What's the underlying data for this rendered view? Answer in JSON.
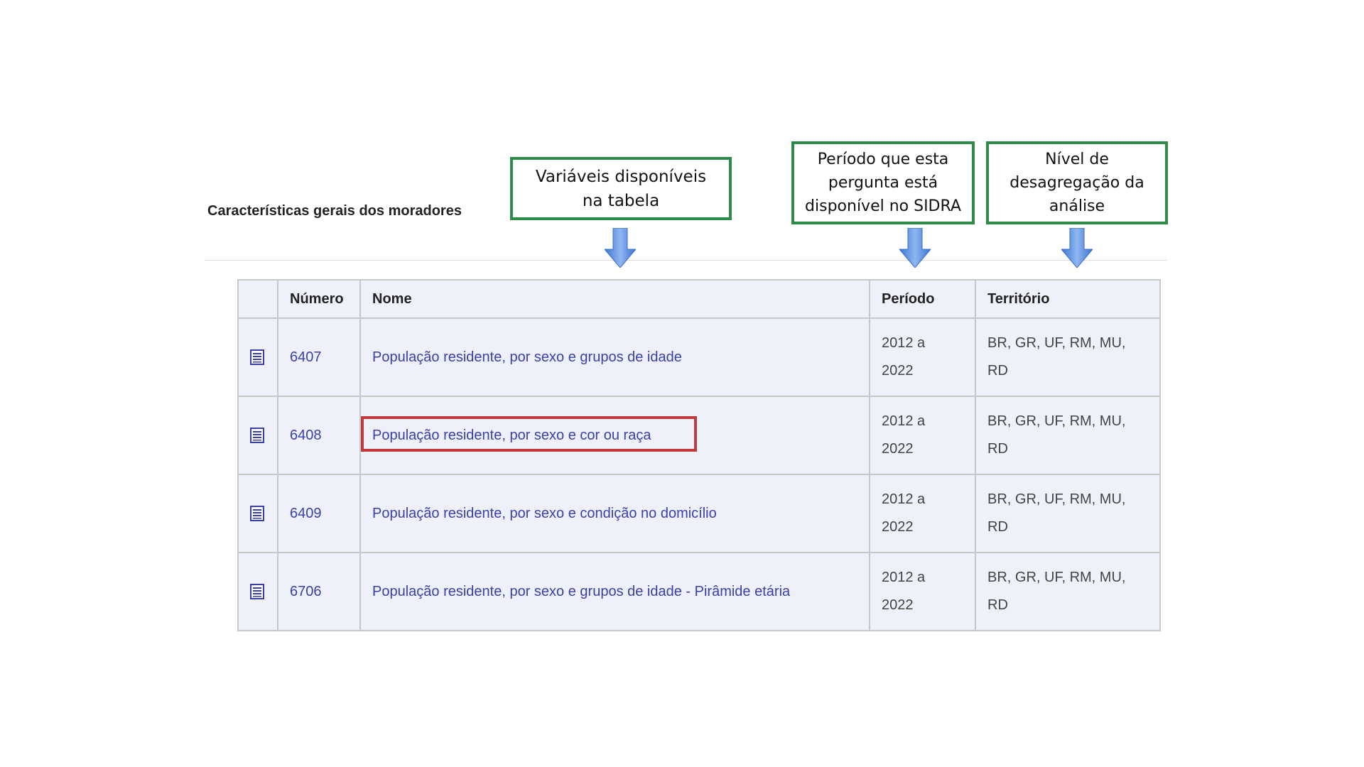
{
  "section": {
    "title": "Características gerais dos moradores"
  },
  "callouts": {
    "variables": {
      "line1": "Variáveis disponíveis",
      "line2": "na tabela"
    },
    "period": {
      "line1": "Período que esta",
      "line2": "pergunta está",
      "line3": "disponível no SIDRA"
    },
    "territory": {
      "line1": "Nível de",
      "line2": "desagregação da",
      "line3": "análise"
    }
  },
  "table": {
    "headers": {
      "icon": "",
      "number": "Número",
      "name": "Nome",
      "period": "Período",
      "territory": "Território"
    },
    "rows": [
      {
        "icon": "table-list-icon",
        "number": "6407",
        "name": "População residente, por sexo e grupos de idade",
        "period_line1": "2012 a",
        "period_line2": "2022",
        "territory_line1": "BR, GR, UF, RM, MU,",
        "territory_line2": "RD"
      },
      {
        "icon": "table-list-icon",
        "number": "6408",
        "name": "População residente, por sexo e cor ou raça",
        "period_line1": "2012 a",
        "period_line2": "2022",
        "territory_line1": "BR, GR, UF, RM, MU,",
        "territory_line2": "RD",
        "highlighted": true
      },
      {
        "icon": "table-list-icon",
        "number": "6409",
        "name": "População residente, por sexo e condição no domicílio",
        "period_line1": "2012 a",
        "period_line2": "2022",
        "territory_line1": "BR, GR, UF, RM, MU,",
        "territory_line2": "RD"
      },
      {
        "icon": "table-list-icon",
        "number": "6706",
        "name": "População residente, por sexo e grupos de idade - Pirâmide etária",
        "period_line1": "2012 a",
        "period_line2": "2022",
        "territory_line1": "BR, GR, UF, RM, MU,",
        "territory_line2": "RD"
      }
    ]
  },
  "colors": {
    "callout_border": "#2e8b47",
    "highlight_border": "#c0393b",
    "arrow": "#4a86e8",
    "link": "#3b3fa8",
    "table_background": "#eef1f9"
  }
}
